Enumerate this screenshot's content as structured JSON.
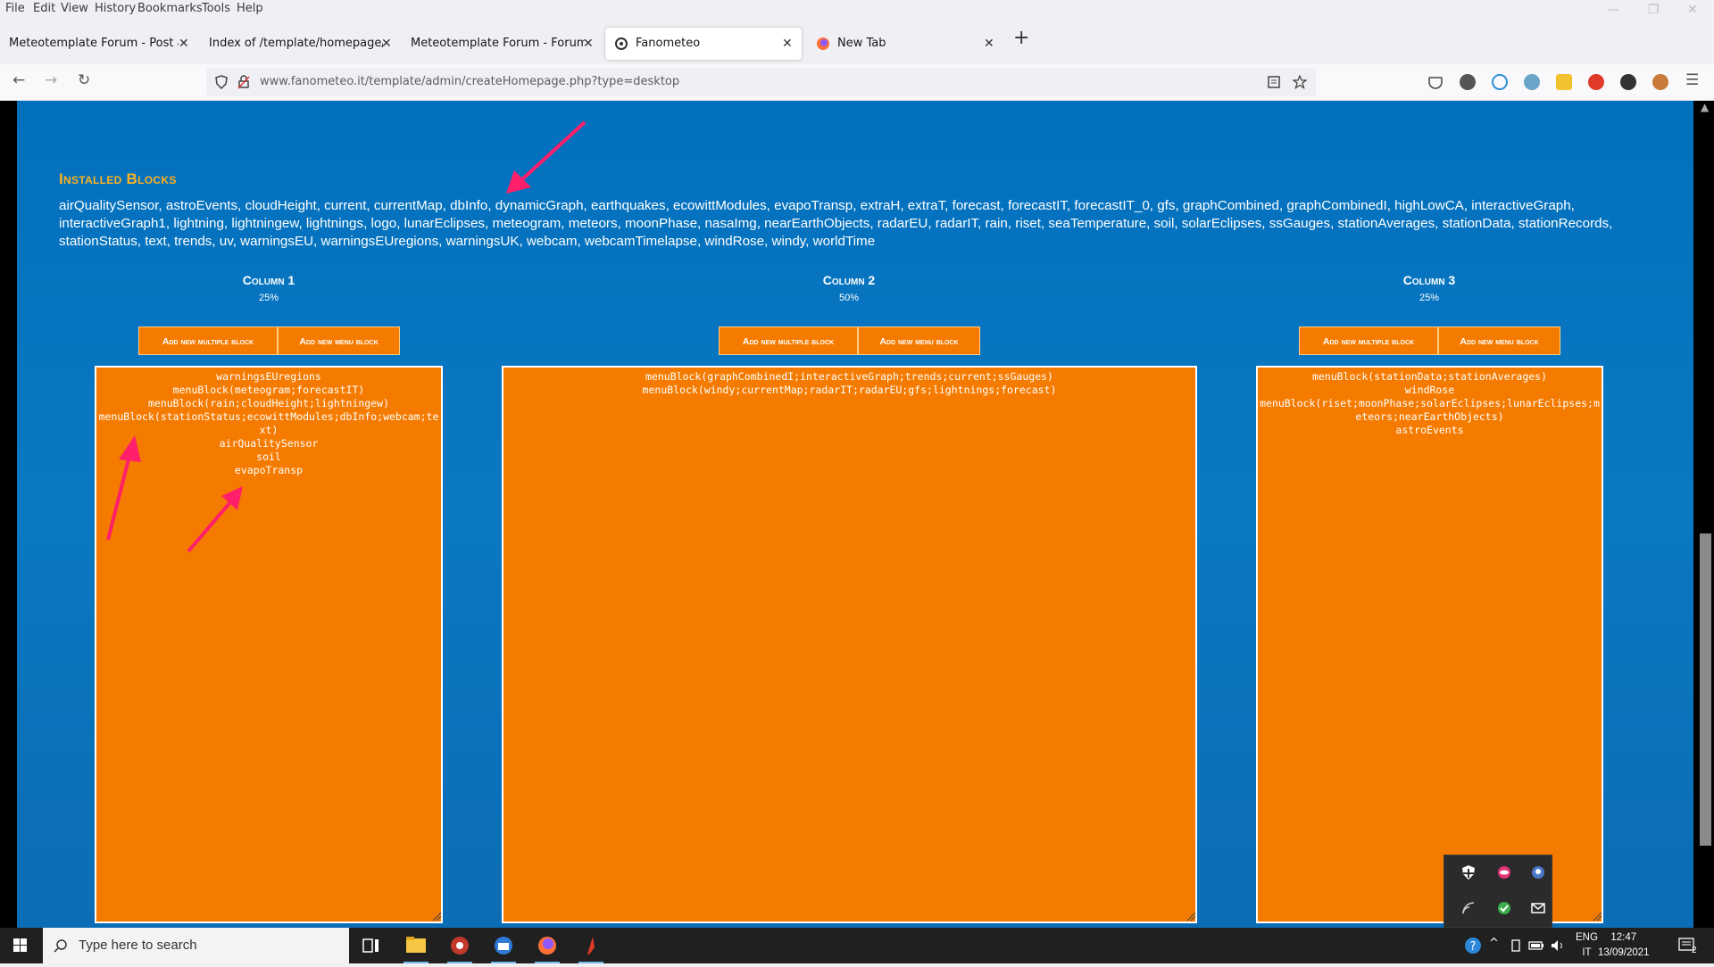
{
  "menu": [
    "File",
    "Edit",
    "View",
    "History",
    "Bookmarks",
    "Tools",
    "Help"
  ],
  "tabs": [
    {
      "title": "Meteotemplate Forum - Post a reply",
      "active": false
    },
    {
      "title": "Index of /template/homepage/blocks",
      "active": false
    },
    {
      "title": "Meteotemplate Forum - Forum Home",
      "active": false
    },
    {
      "title": "Fanometeo",
      "active": true
    },
    {
      "title": "New Tab",
      "active": false
    }
  ],
  "tab_close_glyph": "✕",
  "new_tab_glyph": "+",
  "url": "www.fanometeo.it/template/admin/createHomepage.php?type=desktop",
  "installed": {
    "title": "Installed Blocks",
    "list": "airQualitySensor, astroEvents, cloudHeight, current, currentMap, dbInfo, dynamicGraph, earthquakes, ecowittModules, evapoTransp, extraH, extraT, forecast, forecastIT, forecastIT_0, gfs, graphCombined, graphCombinedI, highLowCA, interactiveGraph, interactiveGraph1, lightning, lightningew, lightnings, logo, lunarEclipses, meteogram, meteors, moonPhase, nasaImg, nearEarthObjects, radarEU, radarIT, rain, riset, seaTemperature, soil, solarEclipses, ssGauges, stationAverages, stationData, stationRecords, stationStatus, text, trends, uv, warningsEU, warningsEUregions, warningsUK, webcam, webcamTimelapse, windRose, windy, worldTime"
  },
  "buttons": {
    "multiple": "Add new multiple block",
    "menu": "Add new menu block"
  },
  "columns": [
    {
      "name": "Column 1",
      "percent": "25%",
      "content": "warningsEUregions\nmenuBlock(meteogram;forecastIT)\nmenuBlock(rain;cloudHeight;lightningew)\nmenuBlock(stationStatus;ecowittModules;dbInfo;webcam;text)\nairQualitySensor\nsoil\nevapoTransp"
    },
    {
      "name": "Column 2",
      "percent": "50%",
      "content": "menuBlock(graphCombinedI;interactiveGraph;trends;current;ssGauges)\nmenuBlock(windy;currentMap;radarIT;radarEU;gfs;lightnings;forecast)"
    },
    {
      "name": "Column 3",
      "percent": "25%",
      "content": "menuBlock(stationData;stationAverages)\nwindRose\nmenuBlock(riset;moonPhase;solarEclipses;lunarEclipses;meteors;nearEarthObjects)\nastroEvents"
    }
  ],
  "taskbar": {
    "search_placeholder": "Type here to search",
    "lang1": "ENG",
    "lang2": "IT",
    "time": "12:47",
    "date": "13/09/2021",
    "notif_count": "2"
  },
  "colors": {
    "accent_orange": "#f57b00",
    "title_gold": "#ffb21f",
    "page_blue": "#0270bd",
    "arrow": "#ff1f6a"
  }
}
